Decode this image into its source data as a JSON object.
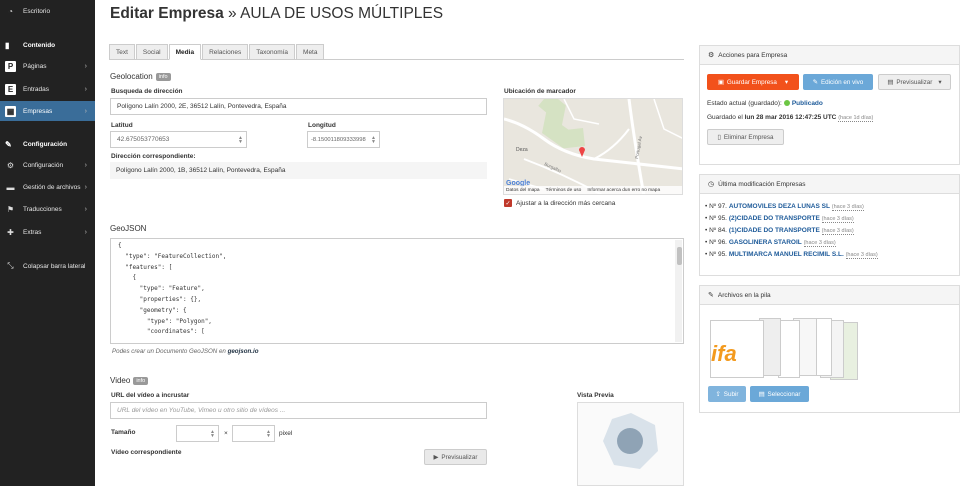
{
  "sidebar": {
    "dashboard": "Escritorio",
    "content_heading": "Contenido",
    "items": [
      {
        "icon": "P",
        "label": "Páginas"
      },
      {
        "icon": "E",
        "label": "Entradas"
      },
      {
        "icon": "building-icon",
        "label": "Empresas"
      }
    ],
    "config_heading": "Configuración",
    "config_items": [
      {
        "icon": "settings-icon",
        "label": "Configuración"
      },
      {
        "icon": "folder-icon",
        "label": "Gestión de archivos"
      },
      {
        "icon": "flag-icon",
        "label": "Traducciones"
      },
      {
        "icon": "plugin-icon",
        "label": "Extras"
      }
    ],
    "collapse": "Colapsar barra lateral"
  },
  "page": {
    "title_bold": "Editar Empresa",
    "title_rest": " » AULA DE USOS MÚLTIPLES"
  },
  "tabs": [
    "Text",
    "Social",
    "Media",
    "Relaciones",
    "Taxonomía",
    "Meta"
  ],
  "geo": {
    "section": "Geolocation",
    "badge": "info",
    "search_label": "Busqueda de dirección",
    "search_value": "Polígono Lalín 2000, 2E, 36512 Lalín, Pontevedra, España",
    "lat_label": "Latitud",
    "lat_value": "42.675053770653",
    "lng_label": "Longitud",
    "lng_value": "-8.150011809333998",
    "addr_label": "Dirección correspondiente:",
    "addr_value": "Polígono Lalín 2000, 1B, 36512 Lalín, Pontevedra, España",
    "map_label": "Ubicación de marcador",
    "map_footer": [
      "Datos del mapa",
      "Términos de uso",
      "Informar acerca dun erro no mapa"
    ],
    "map_streets": [
      "Deza",
      "Burgalho",
      "Portugal Av"
    ],
    "adjust": "Ajustar a la dirección más cercana"
  },
  "geojson": {
    "section": "GeoJSON",
    "lines": [
      "{",
      "  \"type\": \"FeatureCollection\",",
      "  \"features\": [",
      "    {",
      "      \"type\": \"Feature\",",
      "      \"properties\": {},",
      "      \"geometry\": {",
      "        \"type\": \"Polygon\",",
      "        \"coordinates\": ["
    ],
    "hint_prefix": "Podes crear un Documento GeoJSON en ",
    "hint_link": "geojson.io"
  },
  "video": {
    "section": "Video",
    "badge": "info",
    "url_label": "URL del vídeo a incrustar",
    "url_placeholder": "URL del vídeo en YouTube, Vimeo u otro sitio de vídeos ...",
    "size_label": "Tamaño",
    "times": "×",
    "unit": "pixel",
    "match_label": "Vídeo correspondiente",
    "preview_label": "Vista Previa",
    "preview_button": "Previsualizar"
  },
  "actions": {
    "heading": "Acciones para Empresa",
    "save": "Guardar Empresa",
    "live_edit": "Edición en vivo",
    "preview": "Previsualizar",
    "status_prefix": "Estado actual (guardado):",
    "status": "Publicado",
    "saved_prefix": "Guardado el",
    "saved_date": "lun 28 mar 2016 12:47:25 UTC",
    "saved_ago": "(hace 1d días)",
    "delete": "Eliminar Empresa"
  },
  "modifications": {
    "heading": "Última modificación Empresas",
    "items": [
      {
        "num": "• Nº 97.",
        "name": "AUTOMOVILES DEZA LUNAS SL",
        "ago": "(hace 3 días)"
      },
      {
        "num": "• Nº 95.",
        "name": "(2)CIDADE DO TRANSPORTE",
        "ago": "(hace 3 días)"
      },
      {
        "num": "• Nº 84.",
        "name": "(1)CIDADE DO TRANSPORTE",
        "ago": "(hace 3 días)"
      },
      {
        "num": "• Nº 96.",
        "name": "GASOLINERA STAROIL",
        "ago": "(hace 3 días)"
      },
      {
        "num": "• Nº 95.",
        "name": "MULTIMARCA MANUEL RECIMIL S.L.",
        "ago": "(hace 3 días)"
      }
    ]
  },
  "files": {
    "heading": "Archivos en la pila",
    "upload": "Subir",
    "select": "Seleccionar",
    "thumb_text": "ifa"
  },
  "colors": {
    "sidebar": "#222222",
    "active": "#3a6d99",
    "accent": "#f2511b",
    "blue": "#6ba8d8"
  }
}
